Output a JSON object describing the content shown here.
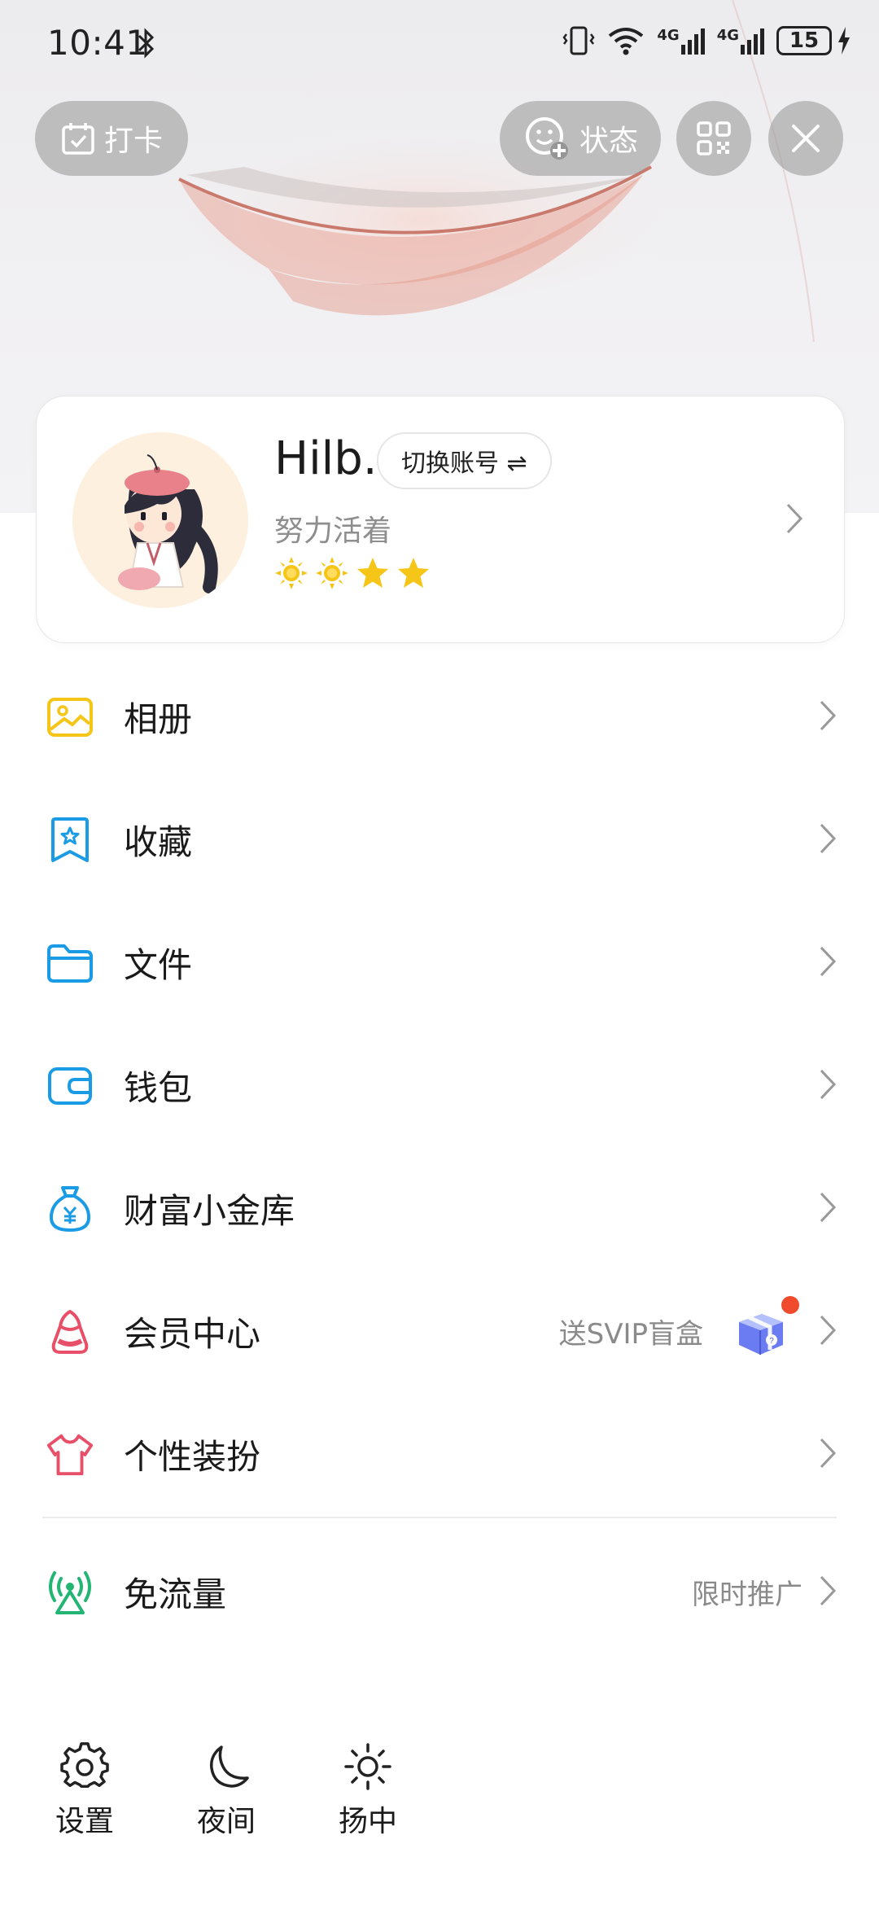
{
  "status_bar": {
    "time": "10:41",
    "network_1": "4G",
    "network_2": "4G",
    "battery": "15"
  },
  "top_actions": {
    "checkin_label": "打卡",
    "status_label": "状态"
  },
  "profile": {
    "nickname": "Hilb.",
    "switch_account_label": "切换账号 ⇌",
    "signature": "努力活着",
    "level_icons": [
      "sun-icon",
      "sun-icon",
      "star-icon",
      "star-icon"
    ]
  },
  "menu": [
    {
      "label": "相册",
      "icon": "album-icon",
      "color": "#f5c518"
    },
    {
      "label": "收藏",
      "icon": "favorites-icon",
      "color": "#1a9be6"
    },
    {
      "label": "文件",
      "icon": "folder-icon",
      "color": "#1a9be6"
    },
    {
      "label": "钱包",
      "icon": "wallet-icon",
      "color": "#1a9be6"
    },
    {
      "label": "财富小金库",
      "icon": "money-bag-icon",
      "color": "#1a9be6"
    },
    {
      "label": "会员中心",
      "icon": "vip-crown-icon",
      "color": "#e8506a",
      "extra": "送SVIP盲盒"
    },
    {
      "label": "个性装扮",
      "icon": "tshirt-icon",
      "color": "#e8506a"
    }
  ],
  "free_data": {
    "label": "免流量",
    "extra": "限时推广",
    "icon": "signal-tower-icon",
    "color": "#22b573"
  },
  "bottom_bar": {
    "settings": "设置",
    "night": "夜间",
    "weather": "扬中"
  }
}
